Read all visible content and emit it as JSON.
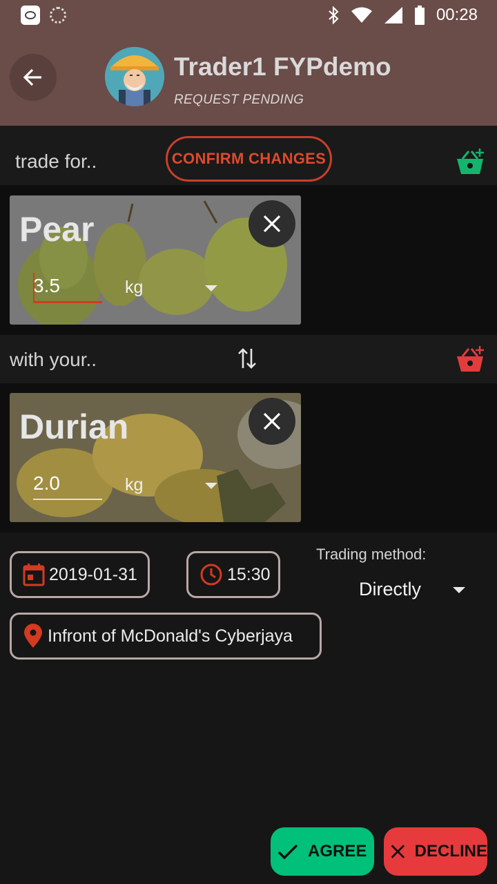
{
  "status_bar": {
    "time": "00:28",
    "icons": [
      "app-icon",
      "loading-icon",
      "bluetooth-icon",
      "wifi-icon",
      "signal-icon",
      "battery-icon"
    ]
  },
  "header": {
    "title": "Trader1 FYPdemo",
    "subtitle": "REQUEST PENDING"
  },
  "trade_for": {
    "label": "trade for..",
    "confirm_label": "CONFIRM CHANGES"
  },
  "offer_item": {
    "name": "Pear",
    "quantity": "3.5",
    "unit": "kg"
  },
  "with_your": {
    "label": "with your.."
  },
  "your_item": {
    "name": "Durian",
    "quantity": "2.0",
    "unit": "kg"
  },
  "details": {
    "date": "2019-01-31",
    "time": "15:30",
    "trading_method_label": "Trading method:",
    "trading_method_value": "Directly",
    "location": "Infront of McDonald's Cyberjaya"
  },
  "actions": {
    "agree": "AGREE",
    "decline": "DECLINE"
  },
  "colors": {
    "header_bg": "#6a4c48",
    "accent_red": "#d43a20",
    "agree_green": "#00c07a",
    "decline_red": "#e63a3d",
    "basket_green": "#13b56d"
  }
}
